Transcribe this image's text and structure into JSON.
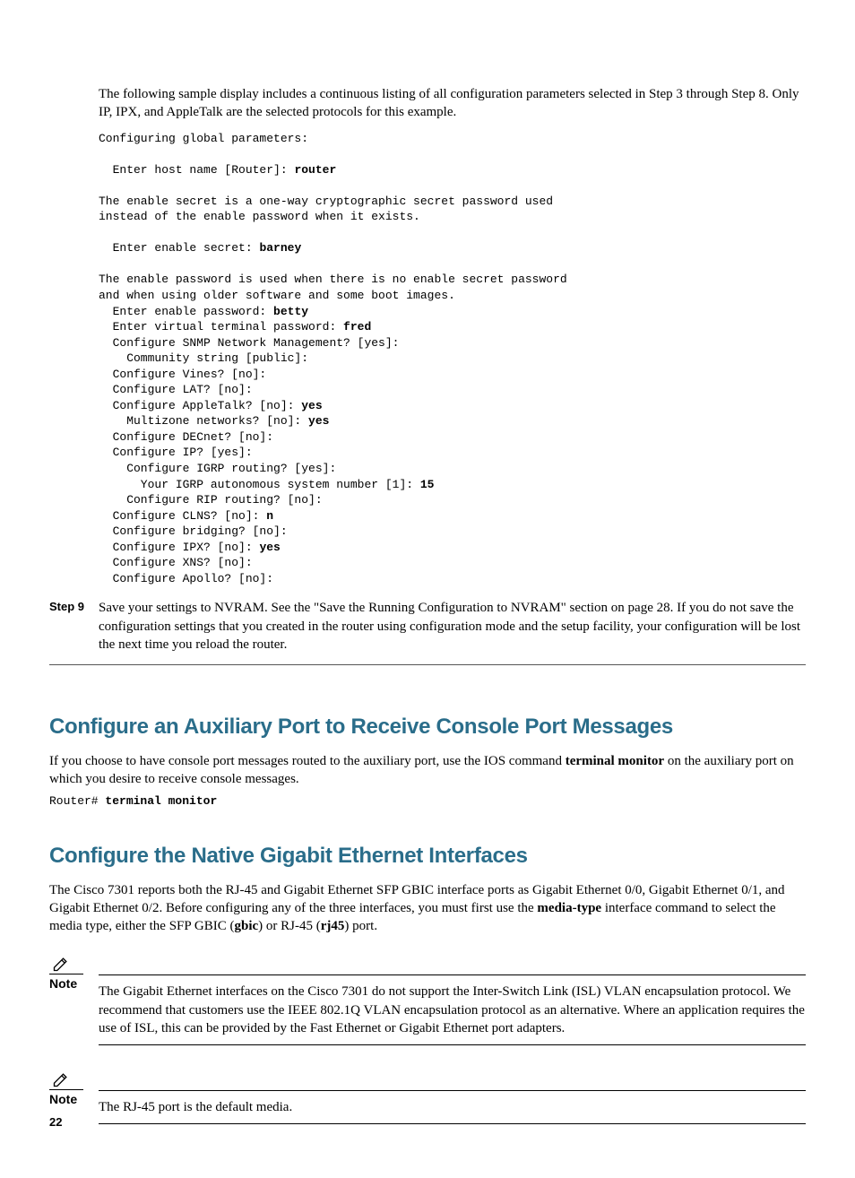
{
  "intro": "The following sample display includes a continuous listing of all configuration parameters selected in Step 3 through Step 8. Only IP, IPX, and AppleTalk are the selected protocols for this example.",
  "term": {
    "l1": "Configuring global parameters:",
    "l2": "  Enter host name [Router]: ",
    "l2b": "router",
    "l3": "The enable secret is a one-way cryptographic secret password used",
    "l4": "instead of the enable password when it exists.",
    "l5": "  Enter enable secret: ",
    "l5b": "barney",
    "l6": "The enable password is used when there is no enable secret password",
    "l7": "and when using older software and some boot images.",
    "l8": "  Enter enable password: ",
    "l8b": "betty",
    "l9": "  Enter virtual terminal password: ",
    "l9b": "fred",
    "l10": "  Configure SNMP Network Management? [yes]:",
    "l11": "    Community string [public]:",
    "l12": "  Configure Vines? [no]:",
    "l13": "  Configure LAT? [no]:",
    "l14": "  Configure AppleTalk? [no]: ",
    "l14b": "yes",
    "l15": "    Multizone networks? [no]: ",
    "l15b": "yes",
    "l16": "  Configure DECnet? [no]:",
    "l17": "  Configure IP? [yes]:",
    "l18": "    Configure IGRP routing? [yes]:",
    "l19": "      Your IGRP autonomous system number [1]: ",
    "l19b": "15",
    "l20": "    Configure RIP routing? [no]:",
    "l21": "  Configure CLNS? [no]: ",
    "l21b": "n",
    "l22": "  Configure bridging? [no]: ",
    "l23": "  Configure IPX? [no]: ",
    "l23b": "yes",
    "l24": "  Configure XNS? [no]: ",
    "l25": "  Configure Apollo? [no]: "
  },
  "step9": {
    "label": "Step 9",
    "body_pre": "Save your settings to NVRAM. See the \"Save the Running Configuration to NVRAM\" section on page 28. If you do not save the configuration settings that you created in the router using configuration mode and the setup facility, your configuration will be lost the next time you reload the router."
  },
  "sec1": {
    "heading": "Configure an Auxiliary Port to Receive Console Port Messages",
    "para_a": "If you choose to have console port messages routed to the auxiliary port, use the IOS command ",
    "para_b": "terminal monitor",
    "para_c": " on the auxiliary port on which you desire to receive console messages.",
    "cmd_a": "Router# ",
    "cmd_b": "terminal monitor"
  },
  "sec2": {
    "heading": "Configure the Native Gigabit Ethernet Interfaces",
    "p1a": "The Cisco 7301 reports both the RJ-45 and Gigabit Ethernet SFP GBIC interface ports as Gigabit Ethernet 0/0, Gigabit Ethernet 0/1, and Gigabit Ethernet 0/2. Before configuring any of the three interfaces, you must first use the ",
    "p1b": "media-type",
    "p1c": " interface command to select the media type, either the SFP GBIC (",
    "p1d": "gbic",
    "p1e": ") or RJ-45 (",
    "p1f": "rj45",
    "p1g": ") port.",
    "note1_label": "Note",
    "note1_text": "The Gigabit Ethernet interfaces on the Cisco 7301 do not support the Inter-Switch Link (ISL) VLAN encapsulation protocol. We recommend that customers use the IEEE 802.1Q VLAN encapsulation protocol as an alternative. Where an application requires the use of ISL, this can be provided by the Fast Ethernet or Gigabit Ethernet port adapters.",
    "note2_label": "Note",
    "note2_text": "The RJ-45 port is the default media."
  },
  "page_number": "22"
}
